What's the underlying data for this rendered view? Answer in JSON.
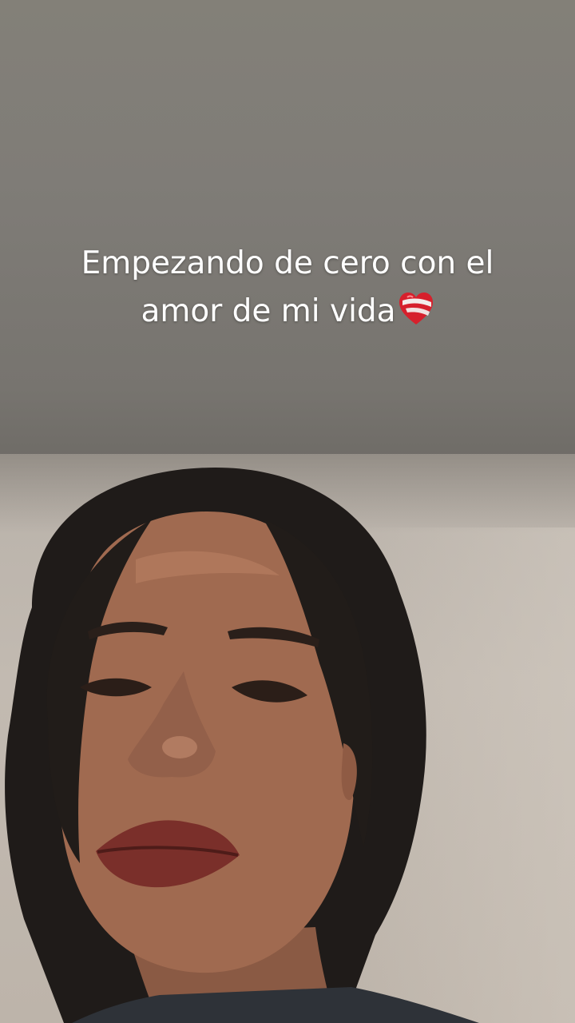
{
  "caption": {
    "line1": "Empezando de cero con el",
    "line2": "amor de mi vida",
    "emoji_icon": "mending-heart-icon"
  },
  "colors": {
    "caption_text": "#ffffff",
    "ceiling": "#7f7c77",
    "wall": "#c2bab1",
    "heart": "#d6202c"
  }
}
